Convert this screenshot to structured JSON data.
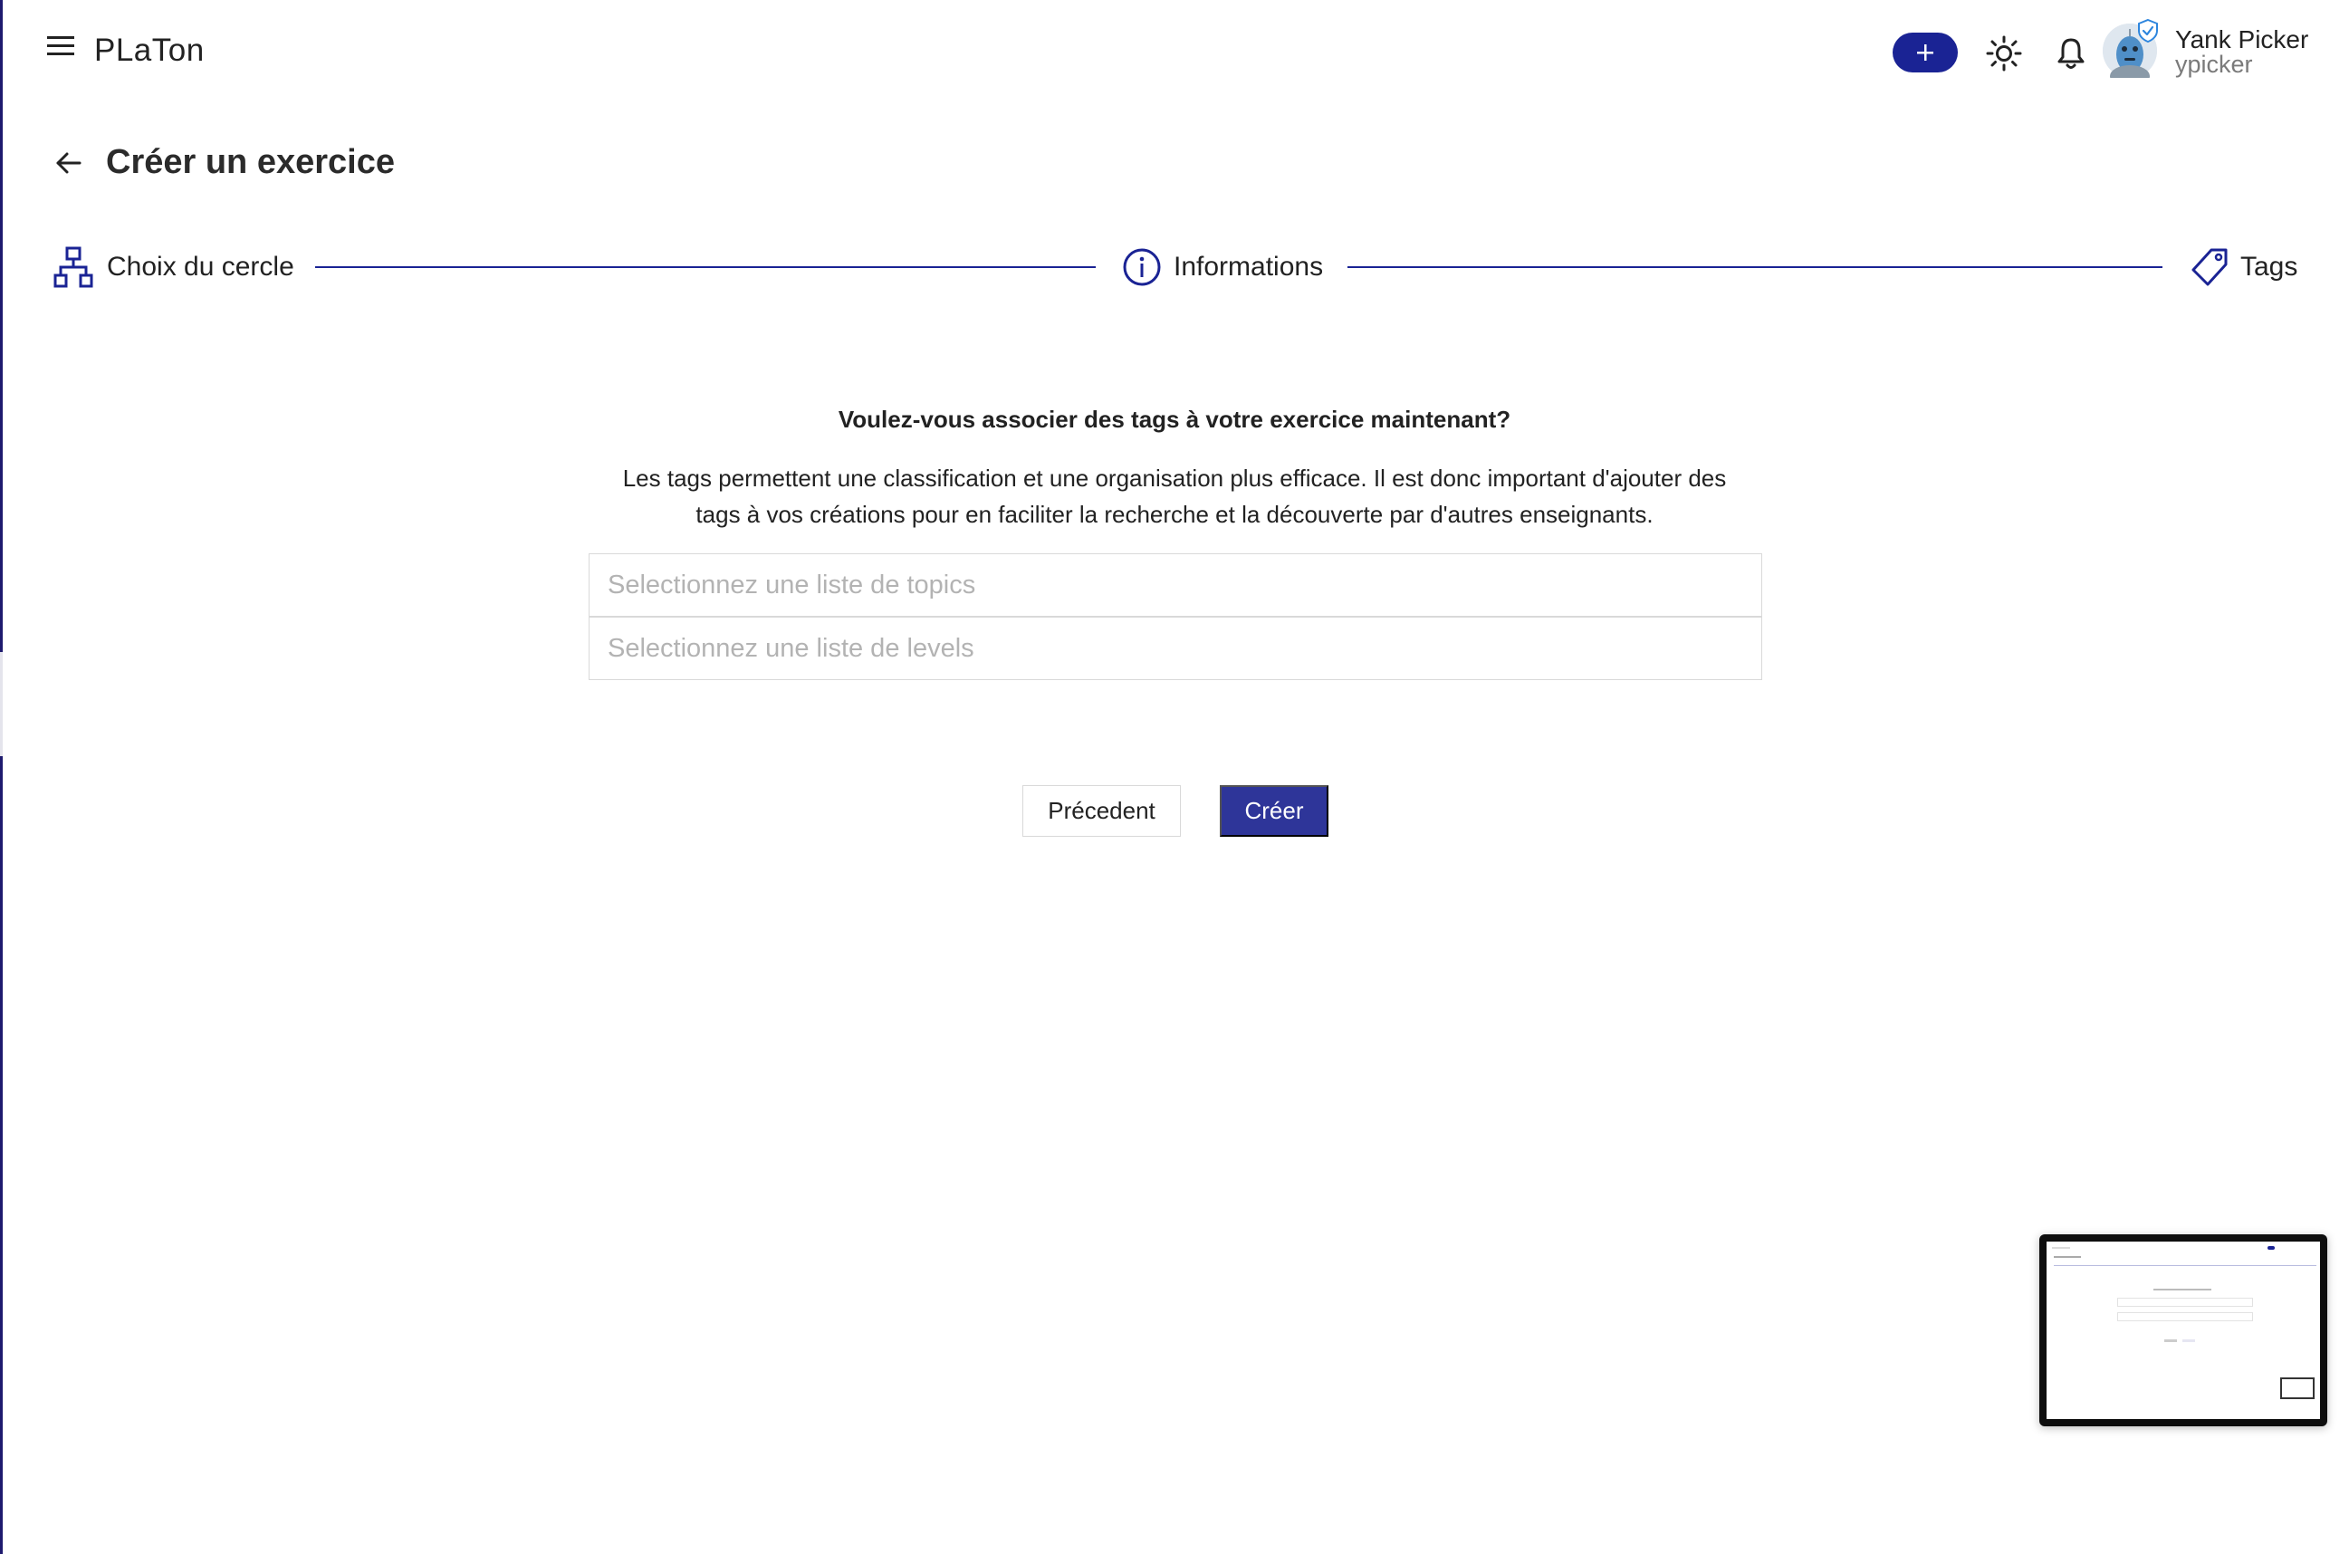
{
  "app": {
    "name": "PLaTon",
    "accent_color": "#1a2394",
    "button_color": "#2e3599"
  },
  "topbar": {
    "menu_icon": "hamburger-menu-icon",
    "add_icon": "plus-icon",
    "theme_icon": "sun-icon",
    "notification_icon": "bell-icon",
    "user": {
      "name": "Yank Picker",
      "login": "ypicker",
      "badge_icon": "verified-shield-icon"
    }
  },
  "page": {
    "title": "Créer un exercice",
    "back_icon": "arrow-left-icon"
  },
  "stepper": {
    "steps": [
      {
        "label": "Choix du cercle",
        "icon": "hierarchy-icon"
      },
      {
        "label": "Informations",
        "icon": "info-circle-icon"
      },
      {
        "label": "Tags",
        "icon": "tag-icon"
      }
    ]
  },
  "main": {
    "question": "Voulez-vous associer des tags à votre exercice maintenant?",
    "description": "Les tags permettent une classification et une organisation plus efficace. Il est donc important d'ajouter des tags à vos créations pour en faciliter la recherche et la découverte par d'autres enseignants.",
    "topics_placeholder": "Selectionnez une liste de topics",
    "levels_placeholder": "Selectionnez une liste de levels",
    "prev_label": "Précedent",
    "create_label": "Créer"
  }
}
